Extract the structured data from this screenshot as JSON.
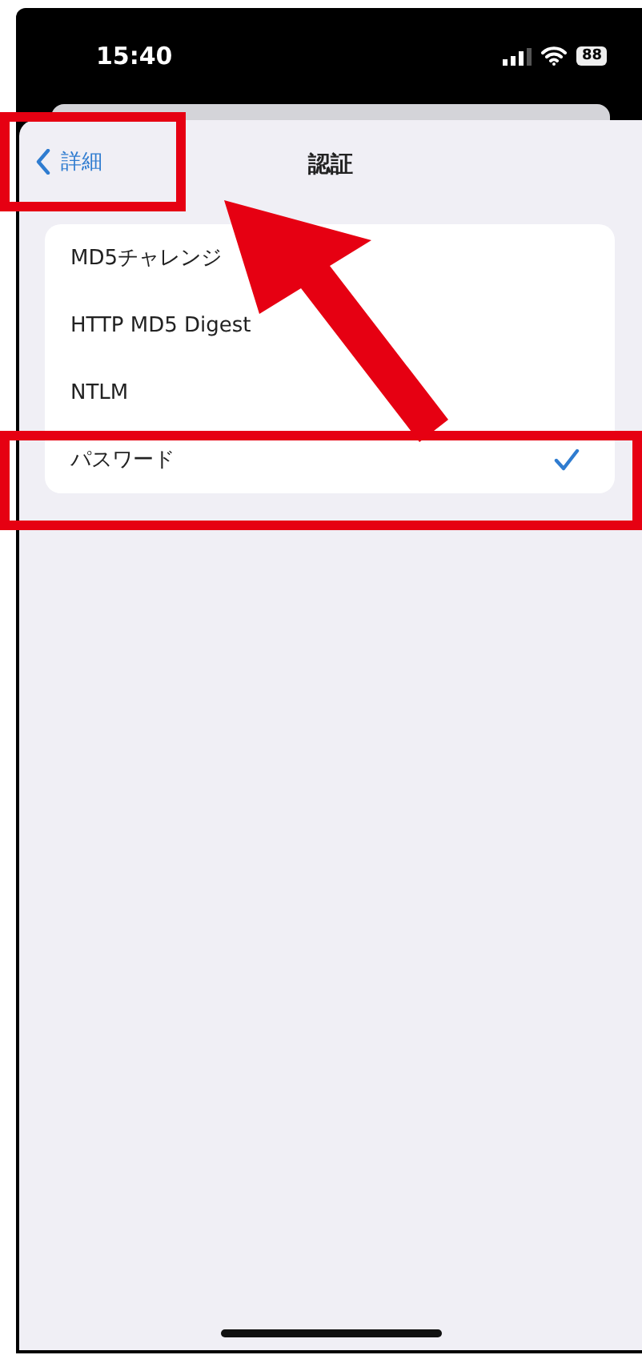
{
  "status_bar": {
    "time": "15:40",
    "battery": "88"
  },
  "nav": {
    "back": "詳細",
    "title": "認証"
  },
  "options": [
    {
      "label": "MD5チャレンジ",
      "selected": false
    },
    {
      "label": "HTTP MD5 Digest",
      "selected": false
    },
    {
      "label": "NTLM",
      "selected": false
    },
    {
      "label": "パスワード",
      "selected": true
    }
  ]
}
